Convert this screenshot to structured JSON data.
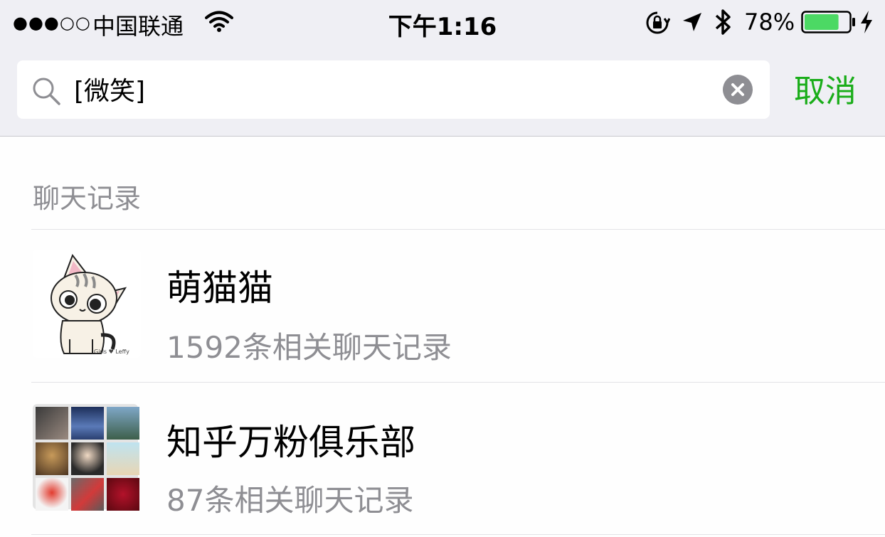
{
  "status_bar": {
    "signal": "●●●○○",
    "carrier": "中国联通",
    "time": "下午1:16",
    "battery_percent": "78%",
    "battery_level": 0.78,
    "battery_color": "#4cd964"
  },
  "search": {
    "query": "[微笑]",
    "cancel_label": "取消"
  },
  "section": {
    "title": "聊天记录"
  },
  "results": [
    {
      "name": "萌猫猫",
      "subtitle": "1592条相关聊天记录"
    },
    {
      "name": "知乎万粉俱乐部",
      "subtitle": "87条相关聊天记录"
    }
  ],
  "colors": {
    "accent": "#1aad19",
    "secondary_text": "#8e8e93",
    "bar_background": "#efeff4"
  }
}
